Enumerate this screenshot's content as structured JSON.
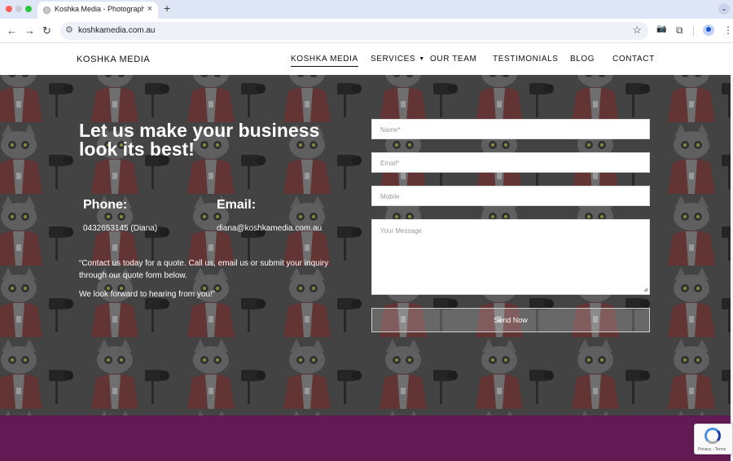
{
  "browser": {
    "tab_title": "Koshka Media - Photography",
    "tab_close": "×",
    "new_tab": "+",
    "url": "koshkamedia.com.au",
    "back": "←",
    "forward": "→",
    "reload": "↻",
    "star": "☆",
    "camera_icon": "📷",
    "extensions_icon": "⧉",
    "menu": "⋮",
    "tab_menu": "⌄"
  },
  "site": {
    "logo": "KOSHKA MEDIA",
    "nav": [
      "KOSHKA MEDIA",
      "SERVICES",
      "OUR TEAM",
      "TESTIMONIALS",
      "BLOG",
      "CONTACT"
    ],
    "services_caret": "▼"
  },
  "hero": {
    "headline": "Let us make your business look its best!",
    "phone_label": "Phone:",
    "phone_value": "0432653145 (Diana)",
    "email_label": "Email:",
    "email_value": "diana@koshkamedia.com.au",
    "para1": "“Contact us today for a quote. Call us, email us or submit your inquiry through our quote form below.",
    "para2": "We look forward to hearing from you!”"
  },
  "form": {
    "name_placeholder": "Name*",
    "email_placeholder": "Email*",
    "mobile_placeholder": "Mobile",
    "message_placeholder": "Your Message",
    "send_label": "Send Now"
  },
  "recaptcha": {
    "text": "Privacy - Terms"
  },
  "colors": {
    "footer": "#621a55",
    "hero_dark": "#4a4a4a"
  }
}
